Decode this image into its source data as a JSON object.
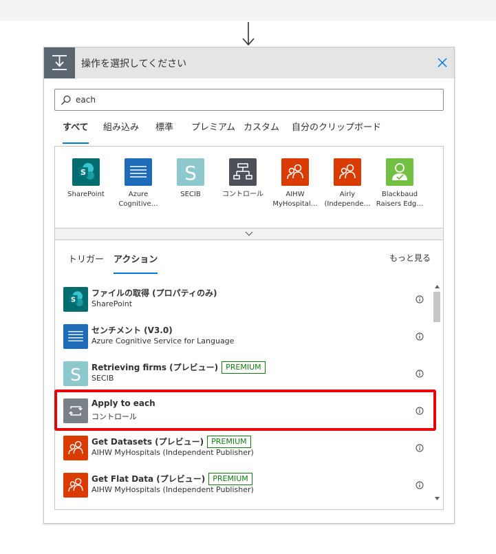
{
  "dialog": {
    "title": "操作を選択してください"
  },
  "search": {
    "value": "each"
  },
  "tabs": [
    {
      "label": "すべて",
      "active": true
    },
    {
      "label": "組み込み"
    },
    {
      "label": "標準"
    },
    {
      "label": "プレミアム"
    },
    {
      "label": "カスタム"
    },
    {
      "label": "自分のクリップボード"
    }
  ],
  "connectors": [
    {
      "label": "SharePoint",
      "label2": "",
      "color": "#036c70",
      "icon": "sharepoint-icon"
    },
    {
      "label": "Azure",
      "label2": "Cognitive…",
      "color": "#1e6bb8",
      "icon": "cognitive-lines-icon"
    },
    {
      "label": "SECIB",
      "label2": "",
      "color": "#8ec8cf",
      "icon": "secib-s-icon"
    },
    {
      "label": "コントロール",
      "label2": "",
      "color": "#4c5058",
      "icon": "control-icon"
    },
    {
      "label": "AIHW",
      "label2": "MyHospital…",
      "color": "#da3b01",
      "icon": "people-icon"
    },
    {
      "label": "Airly",
      "label2": "(Independe…",
      "color": "#da3b01",
      "icon": "people-icon"
    },
    {
      "label": "Blackbaud",
      "label2": "Raisers Edg…",
      "color": "#71c043",
      "icon": "person-check-icon"
    }
  ],
  "subtabs": [
    {
      "label": "トリガー"
    },
    {
      "label": "アクション",
      "active": true
    }
  ],
  "see_more": "もっと見る",
  "actions": [
    {
      "title": "ファイルの取得 (プロパティのみ)",
      "subtitle": "SharePoint",
      "badge": "",
      "color": "#036c70",
      "icon": "sharepoint-icon"
    },
    {
      "title": "センチメント (V3.0)",
      "subtitle": "Azure Cognitive Service for Language",
      "badge": "",
      "color": "#1e6bb8",
      "icon": "cognitive-lines-icon"
    },
    {
      "title": "Retrieving firms (プレビュー)",
      "subtitle": "SECIB",
      "badge": "PREMIUM",
      "color": "#8ec8cf",
      "icon": "secib-s-icon"
    },
    {
      "title": "Apply to each",
      "subtitle": "コントロール",
      "badge": "",
      "color": "#7a8087",
      "icon": "loop-icon"
    },
    {
      "title": "Get Datasets (プレビュー)",
      "subtitle": "AIHW MyHospitals (Independent Publisher)",
      "badge": "PREMIUM",
      "color": "#da3b01",
      "icon": "people-icon"
    },
    {
      "title": "Get Flat Data (プレビュー)",
      "subtitle": "AIHW MyHospitals (Independent Publisher)",
      "badge": "PREMIUM",
      "color": "#da3b01",
      "icon": "people-icon"
    }
  ],
  "colors": {
    "accent": "#0078d4",
    "premium": "#107c10",
    "highlight": "#e8000b"
  }
}
